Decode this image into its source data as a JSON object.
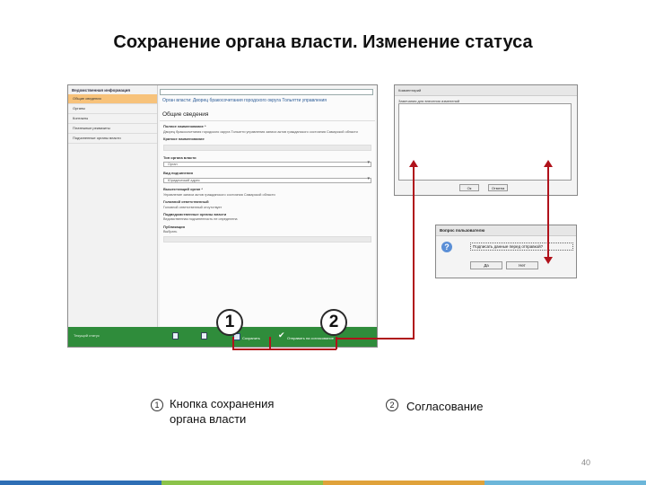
{
  "slide": {
    "title": "Сохранение органа власти. Изменение статуса",
    "page_number": "40",
    "bar_colors": [
      "#2e6eb5",
      "#8bc34a",
      "#e0a23a",
      "#6cb6d9"
    ]
  },
  "screenshot": {
    "left_header": "Ведомственная информация",
    "nav_items": [
      "Общие сведения",
      "Органы",
      "Контакты",
      "Платежные реквизиты",
      "Подчиненные органы власти"
    ],
    "org_title": "Орган власти: Дворец бракосочетания городского округа Тольятти управления",
    "section_title": "Общие сведения",
    "fields": [
      {
        "label": "Полное наименование *",
        "text": "Дворец бракосочетания городского округа Тольятти управления записи актов гражданского состояния Самарской области"
      },
      {
        "label": "Краткое наименование",
        "text": ""
      },
      {
        "label": "Тип органа власти",
        "text": "Орган"
      },
      {
        "label": "Вид подчинения",
        "text": "Юридический адрес"
      },
      {
        "label": "Вышестоящий орган *",
        "text": "Управление записи актов гражданского состояния Самарской области"
      },
      {
        "label": "Головной ответственный",
        "text": "Головной ответственный отсутствует"
      },
      {
        "label": "Подведомственные органы власти",
        "text": "Ведомственная подчиненность не определена"
      },
      {
        "label": "Публикация",
        "text": "Выбрать"
      }
    ],
    "footer_status": "Текущий статус",
    "save_label": "Сохранить",
    "send_label": "Отправить на согласование"
  },
  "comment_dialog": {
    "title": "Комментарий",
    "label": "Замечания для внесения изменений",
    "ok": "Ок",
    "cancel": "Отмена"
  },
  "confirm_dialog": {
    "title": "Вопрос пользователю",
    "message": "Подписать данные перед отправкой?",
    "yes": "Да",
    "no": "Нет"
  },
  "markers": [
    "1",
    "2"
  ],
  "captions": [
    {
      "num": "1",
      "text": "Кнопка сохранения органа власти"
    },
    {
      "num": "2",
      "text": "Согласование"
    }
  ]
}
